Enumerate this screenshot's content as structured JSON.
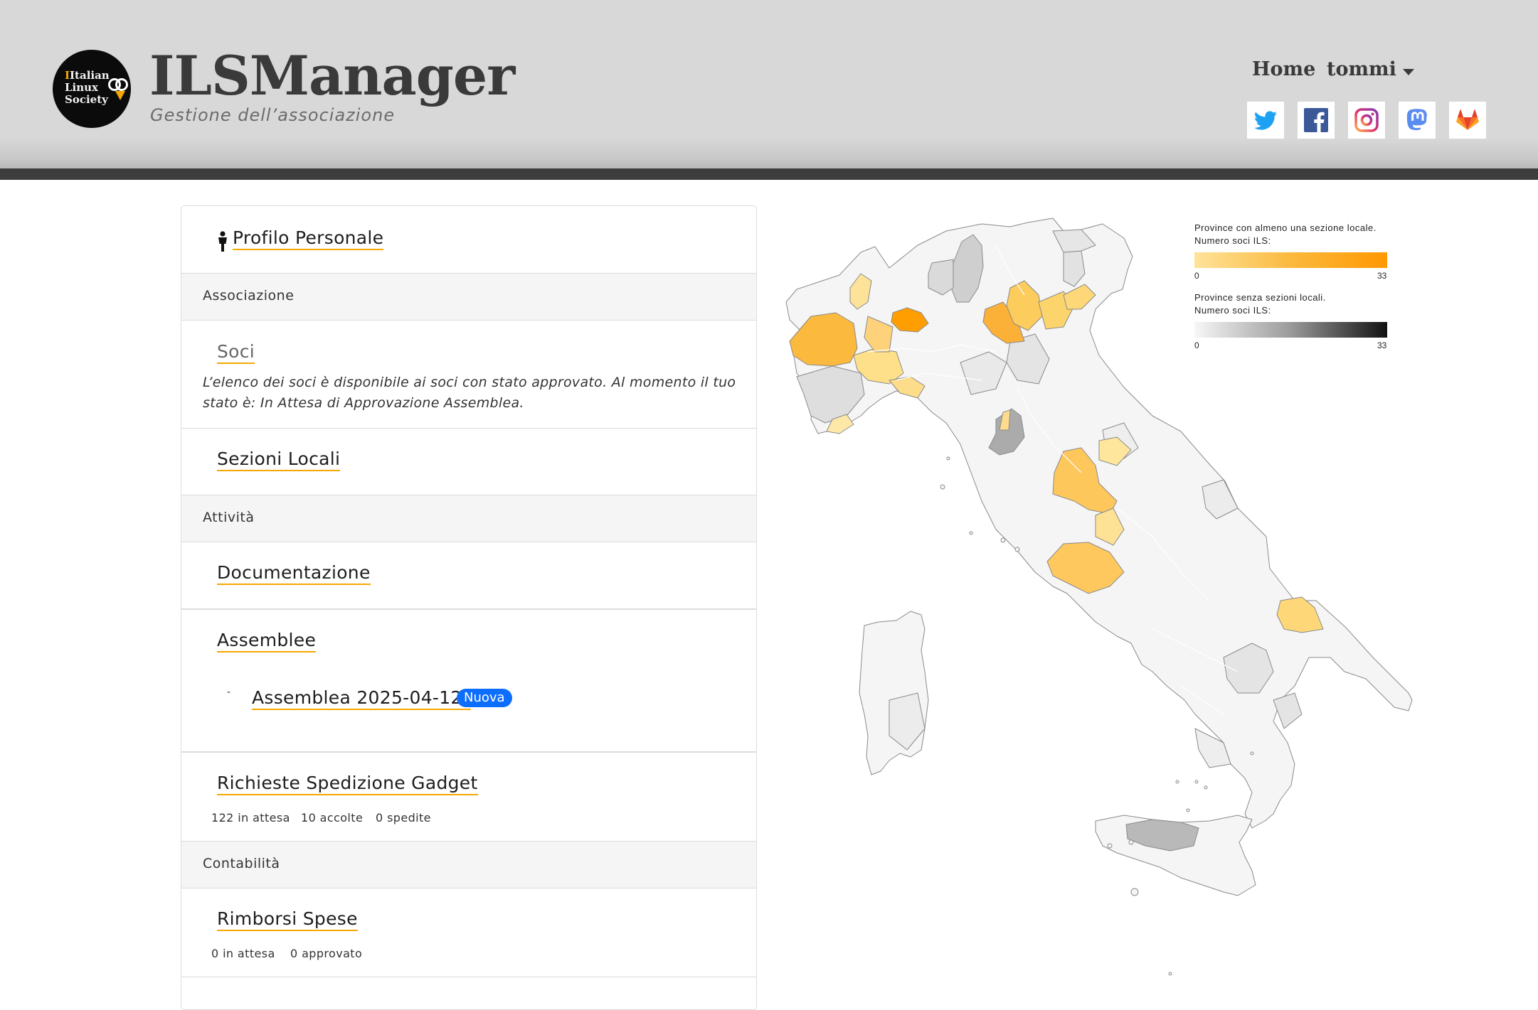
{
  "header": {
    "logo_lines": [
      "Italian",
      "Linux",
      "Society"
    ],
    "title": "ILSManager",
    "subtitle": "Gestione dell’associazione",
    "nav": {
      "home": "Home",
      "user": "tommi"
    },
    "social": [
      "twitter-icon",
      "facebook-icon",
      "instagram-icon",
      "mastodon-icon",
      "gitlab-icon"
    ]
  },
  "sidebar": {
    "profile": "Profilo Personale",
    "section_associazione": "Associazione",
    "soci": "Soci",
    "soci_notice": "L’elenco dei soci è disponibile ai soci con stato approvato. Al momento il tuo stato è: In Attesa di Approvazione Assemblea.",
    "sezioni": "Sezioni Locali",
    "section_attivita": "Attività",
    "documentazione": "Documentazione",
    "assemblee": "Assemblee",
    "assemblea_item": "Assemblea 2025-04-12",
    "assemblea_badge": "Nuova",
    "gadget": "Richieste Spedizione Gadget",
    "gadget_stats": {
      "pending": "122 in attesa",
      "accepted": "10 accolte",
      "shipped": "0 spedite"
    },
    "section_contabilita": "Contabilità",
    "rimborsi": "Rimborsi Spese",
    "rimborsi_stats": {
      "pending": "0 in attesa",
      "approved": "0 approvato"
    }
  },
  "map_legend": {
    "with_sections": {
      "title_line1": "Province con almeno una sezione locale.",
      "title_line2": "Numero soci ILS:",
      "min": "0",
      "max": "33"
    },
    "without_sections": {
      "title_line1": "Province senza sezioni locali.",
      "title_line2": "Numero soci ILS:",
      "min": "0",
      "max": "33"
    }
  },
  "colors": {
    "accent": "#f7a600",
    "badge": "#0d6efd",
    "header_bg": "#d8d8d8",
    "header_bar": "#3d3d3d"
  }
}
